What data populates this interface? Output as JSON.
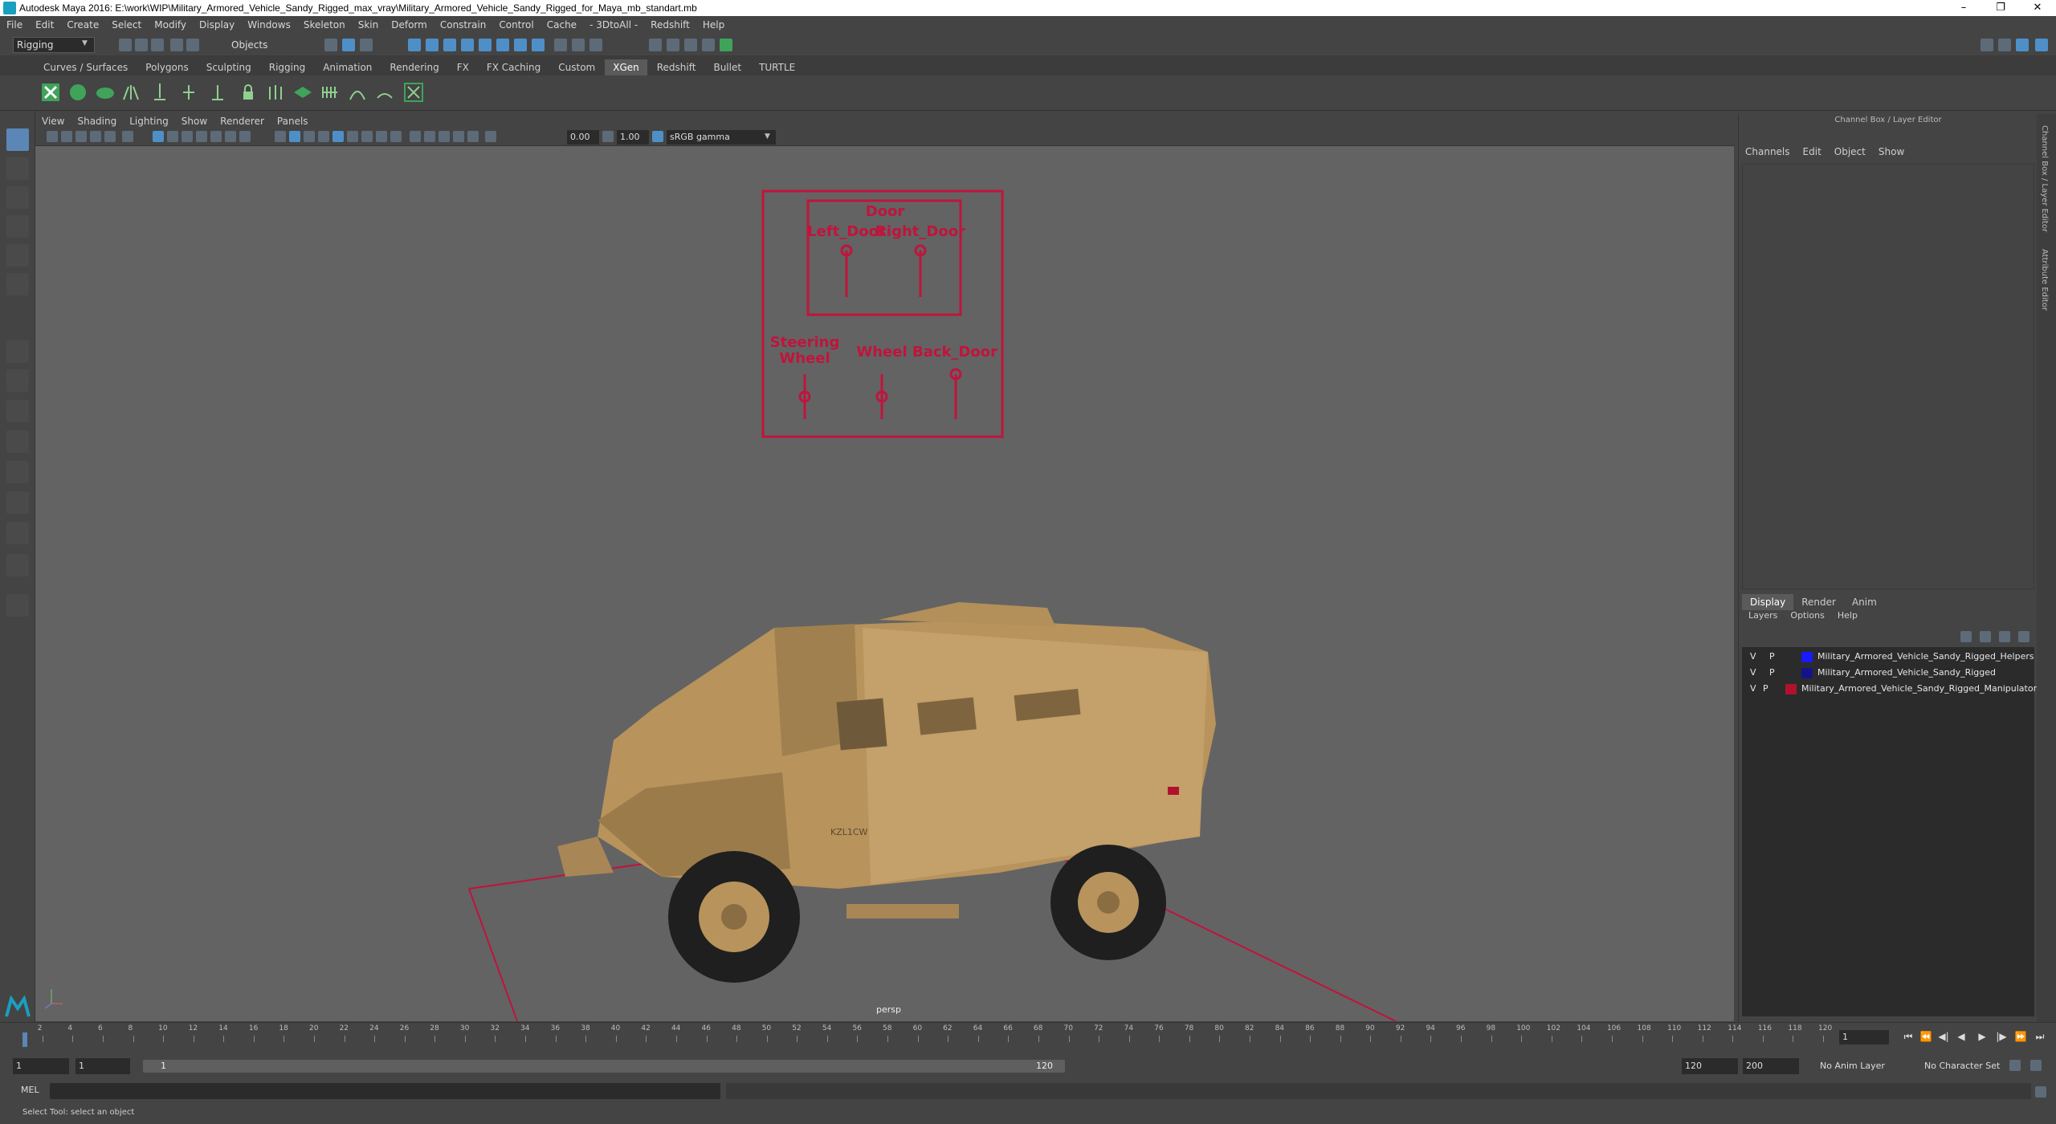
{
  "window": {
    "title": "Autodesk Maya 2016: E:\\work\\WIP\\Military_Armored_Vehicle_Sandy_Rigged_max_vray\\Military_Armored_Vehicle_Sandy_Rigged_for_Maya_mb_standart.mb",
    "controls": {
      "minimize": "–",
      "restore": "❐",
      "close": "✕"
    }
  },
  "menubar": [
    "File",
    "Edit",
    "Create",
    "Select",
    "Modify",
    "Display",
    "Windows",
    "Skeleton",
    "Skin",
    "Deform",
    "Constrain",
    "Control",
    "Cache",
    "- 3DtoAll -",
    "Redshift",
    "Help"
  ],
  "statusline": {
    "mode": "Rigging",
    "selection_mode": "Objects"
  },
  "shelf_tabs": {
    "items": [
      "Curves / Surfaces",
      "Polygons",
      "Sculpting",
      "Rigging",
      "Animation",
      "Rendering",
      "FX",
      "FX Caching",
      "Custom",
      "XGen",
      "Redshift",
      "Bullet",
      "TURTLE"
    ],
    "active": "XGen"
  },
  "viewport": {
    "menu": [
      "View",
      "Shading",
      "Lighting",
      "Show",
      "Renderer",
      "Panels"
    ],
    "exposure": "0.00",
    "gamma": "1.00",
    "color_space": "sRGB gamma",
    "camera_label": "persp",
    "rig_labels": {
      "door": "Door",
      "left_door": "Left_Door",
      "right_door": "Right_Door",
      "steering_1": "Steering",
      "steering_2": "Wheel",
      "wheel": "Wheel",
      "back_door": "Back_Door"
    },
    "vehicle_marking": "KZL1CW"
  },
  "channel_box": {
    "header": "Channel Box / Layer Editor",
    "menu": [
      "Channels",
      "Edit",
      "Object",
      "Show"
    ]
  },
  "layer_editor": {
    "tabs": [
      "Display",
      "Render",
      "Anim"
    ],
    "active_tab": "Display",
    "menu": [
      "Layers",
      "Options",
      "Help"
    ],
    "layers": [
      {
        "v": "V",
        "p": "P",
        "color": "#1a1aff",
        "name": "Military_Armored_Vehicle_Sandy_Rigged_Helpers"
      },
      {
        "v": "V",
        "p": "P",
        "color": "#14148a",
        "name": "Military_Armored_Vehicle_Sandy_Rigged"
      },
      {
        "v": "V",
        "p": "P",
        "color": "#b0122e",
        "name": "Military_Armored_Vehicle_Sandy_Rigged_Manipulator"
      }
    ]
  },
  "side_tabs": [
    "Channel Box / Layer Editor",
    "Attribute Editor"
  ],
  "timeline": {
    "ticks": [
      2,
      4,
      6,
      8,
      10,
      12,
      14,
      16,
      18,
      20,
      22,
      24,
      26,
      28,
      30,
      32,
      34,
      36,
      38,
      40,
      42,
      44,
      46,
      48,
      50,
      52,
      54,
      56,
      58,
      60,
      62,
      64,
      66,
      68,
      70,
      72,
      74,
      76,
      78,
      80,
      82,
      84,
      86,
      88,
      90,
      92,
      94,
      96,
      98,
      100,
      102,
      104,
      106,
      108,
      110,
      112,
      114,
      116,
      118,
      120
    ],
    "current_frame": "1",
    "playback": [
      "⏮",
      "⏪",
      "◀|",
      "◀",
      "▶",
      "|▶",
      "⏩",
      "⏭"
    ]
  },
  "range": {
    "start": "1",
    "playback_start": "1",
    "bar_start": "1",
    "bar_end": "120",
    "playback_end": "120",
    "end": "200",
    "anim_layer": "No Anim Layer",
    "character_set": "No Character Set"
  },
  "command_line": {
    "label": "MEL"
  },
  "help_line": {
    "text": "Select Tool: select an object"
  },
  "colors": {
    "accent": "#5c86b6",
    "rig": "#c0143c",
    "vehicle": "#c4a06a"
  }
}
